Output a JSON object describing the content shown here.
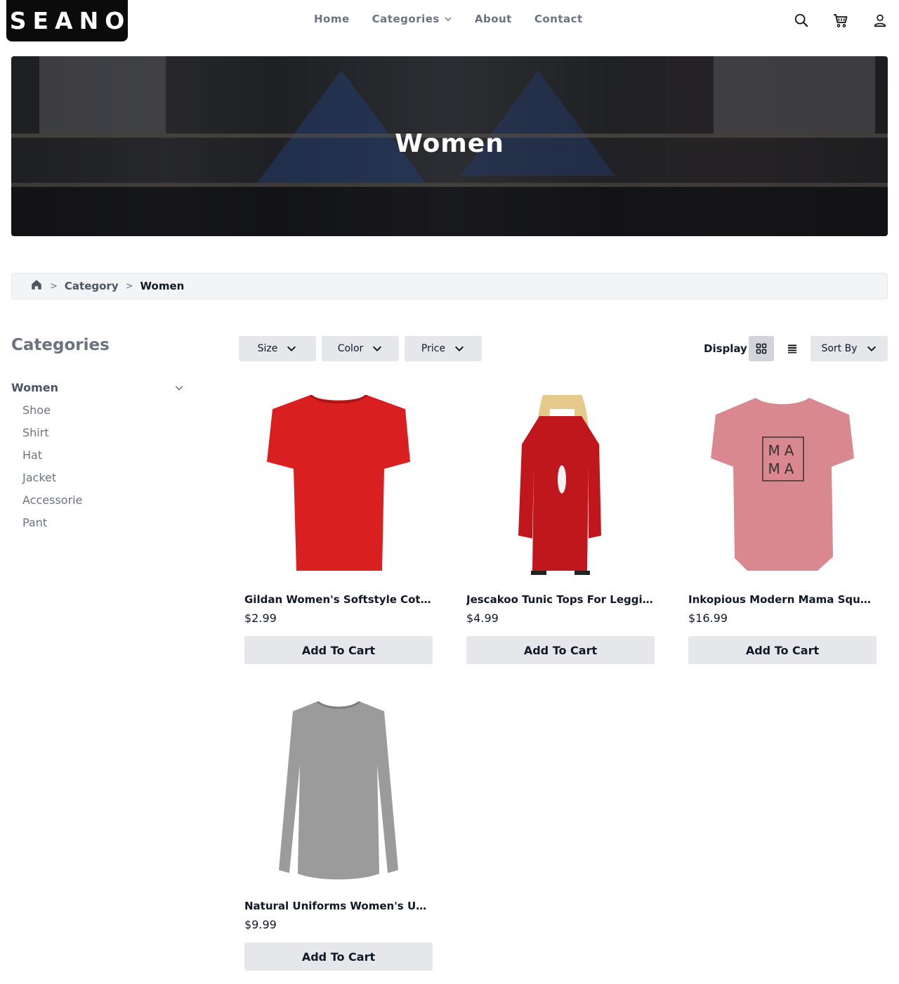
{
  "brand": {
    "logo_text": "SEANO"
  },
  "nav": [
    {
      "label": "Home"
    },
    {
      "label": "Categories",
      "has_dropdown": true
    },
    {
      "label": "About"
    },
    {
      "label": "Contact"
    }
  ],
  "header_icons": [
    "search-icon",
    "cart-icon",
    "user-icon"
  ],
  "hero": {
    "title": "Women"
  },
  "breadcrumb": {
    "items": [
      "Category",
      "Women"
    ]
  },
  "sidebar": {
    "title": "Categories",
    "group": "Women",
    "items": [
      "Shoe",
      "Shirt",
      "Hat",
      "Jacket",
      "Accessorie",
      "Pant"
    ]
  },
  "filters": {
    "size": "Size",
    "color": "Color",
    "price": "Price"
  },
  "display": {
    "label": "Display",
    "active_view": "grid"
  },
  "sort": {
    "label": "Sort By"
  },
  "products": [
    {
      "name": "Gildan Women's Softstyle Cotton T-Shirt",
      "price": "$2.99",
      "button": "Add To Cart",
      "color": "#d91f1f"
    },
    {
      "name": "Jescakoo Tunic Tops For Leggings Women",
      "price": "$4.99",
      "button": "Add To Cart",
      "color": "#c0171c"
    },
    {
      "name": "Inkopious Modern Mama Square Tee",
      "price": "$16.99",
      "button": "Add To Cart",
      "color": "#d9888f"
    },
    {
      "name": "Natural Uniforms Women's Underscrub Tee",
      "price": "$9.99",
      "button": "Add To Cart",
      "color": "#9b9b9b"
    }
  ]
}
